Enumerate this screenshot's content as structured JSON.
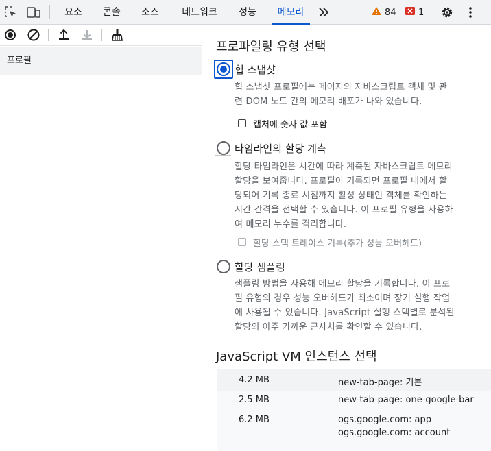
{
  "tabs": [
    {
      "label": "요소"
    },
    {
      "label": "콘솔"
    },
    {
      "label": "소스"
    },
    {
      "label": "네트워크"
    },
    {
      "label": "성능"
    },
    {
      "label": "메모리",
      "active": true
    }
  ],
  "status": {
    "warnings": "84",
    "errors": "1"
  },
  "icons": {
    "inspect": "inspect-element-icon",
    "device": "device-toolbar-icon",
    "more_tabs": "chevron-double-right-icon",
    "warning": "warning-triangle-icon",
    "error": "error-badge-icon",
    "settings": "gear-icon",
    "menu": "vertical-dots-icon",
    "record": "record-icon",
    "clear": "clear-icon",
    "load": "upload-icon",
    "save": "download-icon",
    "gc": "broom-icon"
  },
  "colors": {
    "accent": "#0b57d0",
    "warning": "#e37400",
    "error": "#d93025"
  },
  "sidebar": {
    "profiles_label": "프로필"
  },
  "main": {
    "select_profiling_type": "프로파일링 유형 선택",
    "options": [
      {
        "label": "힙 스냅샷",
        "checked": true,
        "desc_lines": [
          "힙 스냅샷 프로필에는 페이지의 자바스크립트 객체 및 관",
          "련 DOM 노드 간의 메모리 배포가 나와 있습니다."
        ],
        "checkbox": {
          "label": "캡처에 숫자 값 포함",
          "disabled": false
        }
      },
      {
        "label": "타임라인의 할당 계측",
        "checked": false,
        "desc_lines": [
          "할당 타임라인은 시간에 따라 계측된 자바스크립트 메모리",
          "할당을 보여줍니다. 프로필이 기록되면 프로필 내에서 할",
          "당되어 기록 종료 시점까지 활성 상태인 객체를 확인하는",
          "시간 간격을 선택할 수 있습니다. 이 프로필 유형을 사용하",
          "여 메모리 누수를 격리합니다."
        ],
        "checkbox": {
          "label": "할당 스택 트레이스 기록(추가 성능 오버헤드)",
          "disabled": true
        }
      },
      {
        "label": "할당 샘플링",
        "checked": false,
        "desc_lines": [
          "샘플링 방법을 사용해 메모리 할당을 기록합니다. 이 프로",
          "필 유형의 경우 성능 오버헤드가 최소이며 장기 실행 작업",
          "에 사용될 수 있습니다. JavaScript 실행 스택별로 분석된",
          "할당의 아주 가까운 근사치를 확인할 수 있습니다."
        ]
      }
    ],
    "vm_heading": "JavaScript VM 인스턴스 선택",
    "vm_instances": [
      {
        "size": "4.2 MB",
        "names": [
          "new-tab-page: 기본"
        ]
      },
      {
        "size": "2.5 MB",
        "names": [
          "new-tab-page: one-google-bar"
        ]
      },
      {
        "size": "6.2 MB",
        "names": [
          "ogs.google.com: app",
          "ogs.google.com: account"
        ]
      }
    ]
  }
}
